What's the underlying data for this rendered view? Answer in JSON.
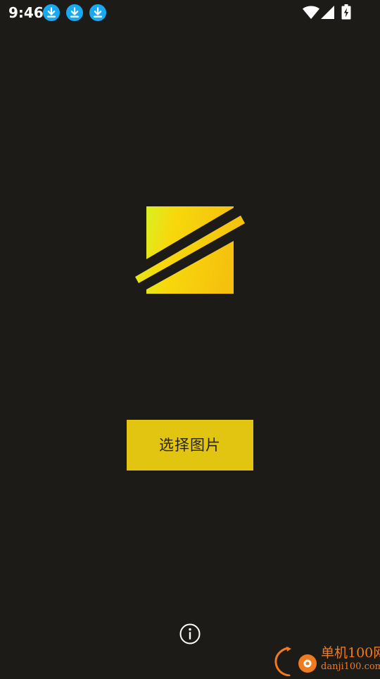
{
  "status_bar": {
    "time": "9:46",
    "notification_icons": [
      "download-icon",
      "download-icon",
      "download-icon"
    ],
    "system_icons": [
      "wifi-icon",
      "cellular-signal-icon",
      "battery-charging-icon"
    ]
  },
  "logo": {
    "icon": "app-logo-icon",
    "gradient_start": "#d9f021",
    "gradient_end": "#f5c10e"
  },
  "main": {
    "pick_image_label": "选择图片"
  },
  "footer": {
    "info_icon": "info-icon"
  },
  "watermark": {
    "title": "单机100网",
    "url": "danji100.com"
  },
  "colors": {
    "background": "#1d1b17",
    "button": "#e1c511",
    "download_badge": "#18a9f0",
    "watermark": "#f07a1e"
  }
}
